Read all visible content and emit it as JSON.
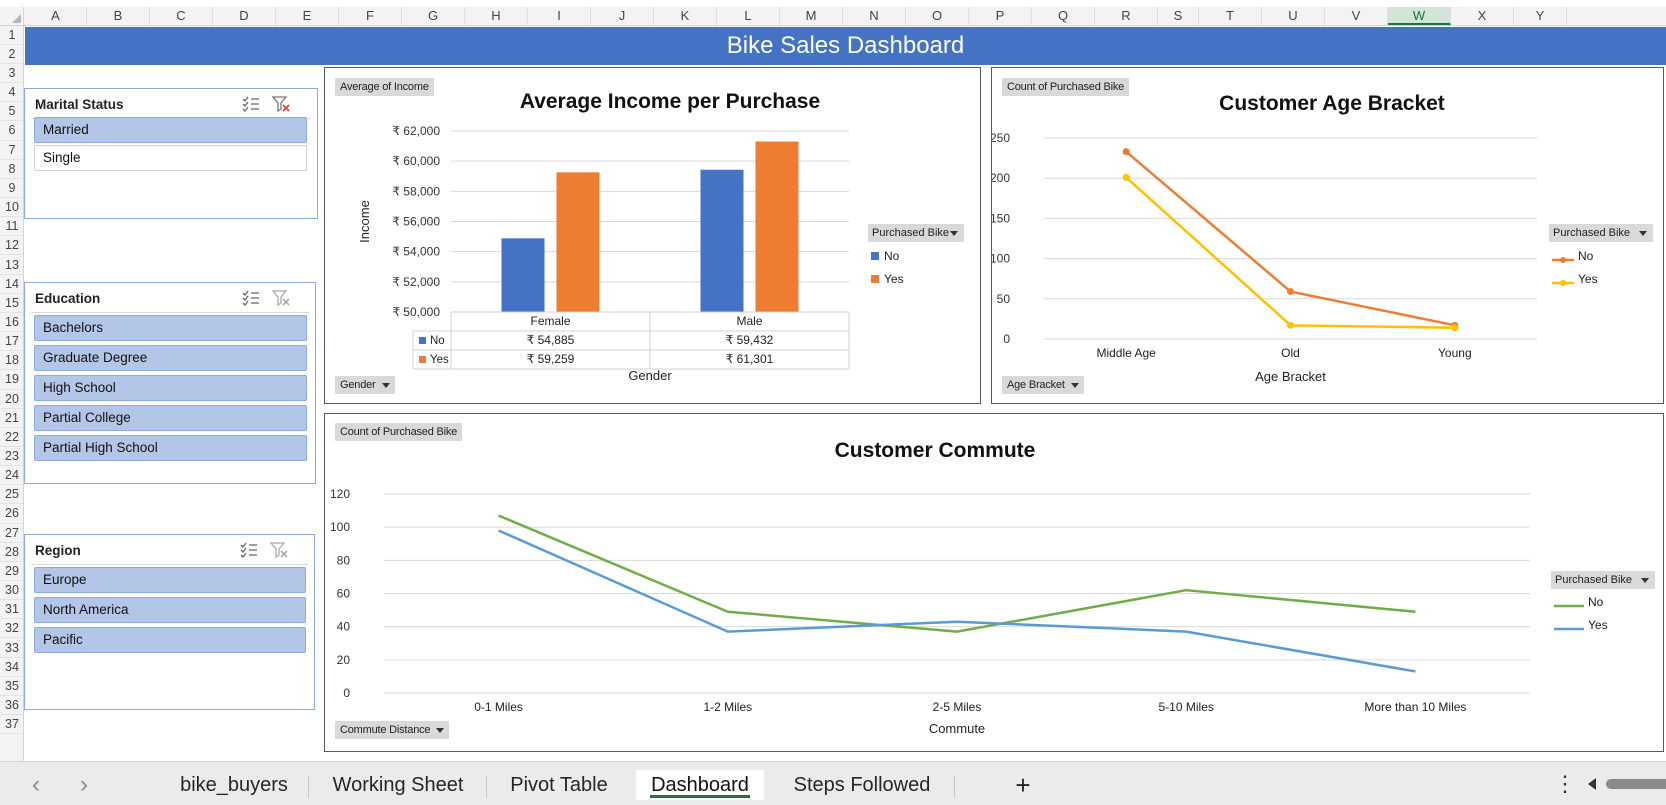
{
  "grid": {
    "columns": [
      "A",
      "B",
      "C",
      "D",
      "E",
      "F",
      "G",
      "H",
      "I",
      "J",
      "K",
      "L",
      "M",
      "N",
      "O",
      "P",
      "Q",
      "R",
      "S",
      "T",
      "U",
      "V",
      "W",
      "X",
      "Y"
    ],
    "active_column": "W",
    "rows": [
      "1",
      "2",
      "3",
      "4",
      "5",
      "6",
      "7",
      "8",
      "9",
      "10",
      "11",
      "12",
      "13",
      "14",
      "15",
      "16",
      "17",
      "18",
      "19",
      "20",
      "21",
      "22",
      "23",
      "24",
      "25",
      "26",
      "27",
      "28",
      "29",
      "30",
      "31",
      "32",
      "33",
      "34",
      "35",
      "36",
      "37"
    ]
  },
  "banner": {
    "title": "Bike Sales Dashboard"
  },
  "slicers": {
    "marital": {
      "title": "Marital Status",
      "items": [
        {
          "label": "Married",
          "selected": true
        },
        {
          "label": "Single",
          "selected": false
        }
      ]
    },
    "education": {
      "title": "Education",
      "items": [
        {
          "label": "Bachelors",
          "selected": true
        },
        {
          "label": "Graduate Degree",
          "selected": true
        },
        {
          "label": "High School",
          "selected": true
        },
        {
          "label": "Partial College",
          "selected": true
        },
        {
          "label": "Partial High School",
          "selected": true
        }
      ]
    },
    "region": {
      "title": "Region",
      "items": [
        {
          "label": "Europe",
          "selected": true
        },
        {
          "label": "North America",
          "selected": true
        },
        {
          "label": "Pacific",
          "selected": true
        }
      ]
    }
  },
  "charts": {
    "income": {
      "value_button": "Average of Income",
      "axis_button": "Gender",
      "legend_button": "Purchased Bike",
      "table_rows": [
        {
          "label": "No",
          "cells": [
            "₹ 54,885",
            "₹ 59,432"
          ]
        },
        {
          "label": "Yes",
          "cells": [
            "₹ 59,259",
            "₹ 61,301"
          ]
        }
      ]
    },
    "age": {
      "value_button": "Count of Purchased Bike",
      "axis_button": "Age Bracket",
      "legend_button": "Purchased Bike"
    },
    "commute": {
      "value_button": "Count of Purchased Bike",
      "axis_button": "Commute Distance",
      "legend_button": "Purchased Bike"
    }
  },
  "chart_data": [
    {
      "type": "bar",
      "title": "Average Income per Purchase",
      "xlabel": "Gender",
      "ylabel": "Income",
      "categories": [
        "Female",
        "Male"
      ],
      "series": [
        {
          "name": "No",
          "values": [
            54885,
            59432
          ],
          "color": "#4472c4"
        },
        {
          "name": "Yes",
          "values": [
            59259,
            61301
          ],
          "color": "#ed7d31"
        }
      ],
      "ylim": [
        50000,
        62000
      ],
      "yticks": [
        "₹ 50,000",
        "₹ 52,000",
        "₹ 54,000",
        "₹ 56,000",
        "₹ 58,000",
        "₹ 60,000",
        "₹ 62,000"
      ],
      "legend": "right",
      "data_table": true,
      "grid": true
    },
    {
      "type": "line",
      "title": "Customer Age Bracket",
      "xlabel": "Age Bracket",
      "ylabel": "",
      "categories": [
        "Middle Age",
        "Old",
        "Young"
      ],
      "series": [
        {
          "name": "No",
          "values": [
            233,
            59,
            17
          ],
          "color": "#ed7d31"
        },
        {
          "name": "Yes",
          "values": [
            201,
            17,
            14
          ],
          "color": "#ffc000"
        }
      ],
      "ylim": [
        0,
        250
      ],
      "yticks": [
        "0",
        "50",
        "100",
        "150",
        "200",
        "250"
      ],
      "markers": true,
      "legend": "right",
      "grid": true
    },
    {
      "type": "line",
      "title": "Customer Commute",
      "xlabel": "Commute",
      "ylabel": "",
      "categories": [
        "0-1 Miles",
        "1-2 Miles",
        "2-5 Miles",
        "5-10 Miles",
        "More than 10 Miles"
      ],
      "series": [
        {
          "name": "No",
          "values": [
            107,
            49,
            37,
            62,
            49
          ],
          "color": "#70ad47"
        },
        {
          "name": "Yes",
          "values": [
            98,
            37,
            43,
            37,
            13
          ],
          "color": "#5b9bd5"
        }
      ],
      "ylim": [
        0,
        120
      ],
      "yticks": [
        "0",
        "20",
        "40",
        "60",
        "80",
        "100",
        "120"
      ],
      "legend": "right",
      "grid": true
    }
  ],
  "tabs": {
    "sheets": [
      "bike_buyers",
      "Working Sheet",
      "Pivot Table",
      "Dashboard",
      "Steps Followed"
    ],
    "active": "Dashboard",
    "add_label": "+"
  }
}
